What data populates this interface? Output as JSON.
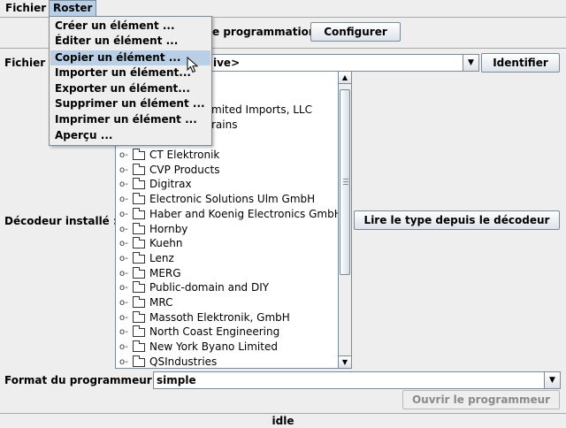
{
  "menubar": {
    "items": [
      "Fichier",
      "Roster"
    ]
  },
  "top_row": {
    "label_partial": "e programmation",
    "configure_button": "Configurer"
  },
  "file_row": {
    "label_partial": "Fichier",
    "combo_value_partial": "ive>",
    "identify_button": "Identifier"
  },
  "decoder": {
    "label": "Décodeur installé :",
    "read_button": "Lire le type depuis le décodeur",
    "tree_partial": [
      "mited Imports, LLC",
      "rains",
      "s"
    ],
    "tree_items": [
      "CT Elektronik",
      "CVP Products",
      "Digitrax",
      "Electronic Solutions Ulm GmbH",
      "Haber and Koenig Electronics GmbH",
      "Hornby",
      "Kuehn",
      "Lenz",
      "MERG",
      "Public-domain and DIY",
      "MRC",
      "Massoth Elektronik, GmbH",
      "North Coast Engineering",
      "New York Byano Limited",
      "QSIndustries"
    ]
  },
  "programmer": {
    "label": "Format du programmeur :",
    "value": "simple",
    "open_button": "Ouvrir le programmeur"
  },
  "status": "idle",
  "roster_menu": {
    "items": [
      "Créer un élément ...",
      "Éditer un élément ...",
      "Copier un élément ...",
      "Importer un élément...",
      "Exporter un élément...",
      "Supprimer un élément ...",
      "Imprimer un élément ...",
      "Aperçu ..."
    ],
    "highlighted_index": 2
  },
  "colors": {
    "highlight": "#b8cfe5",
    "border": "#7a8a99",
    "background": "#eeeeee"
  }
}
